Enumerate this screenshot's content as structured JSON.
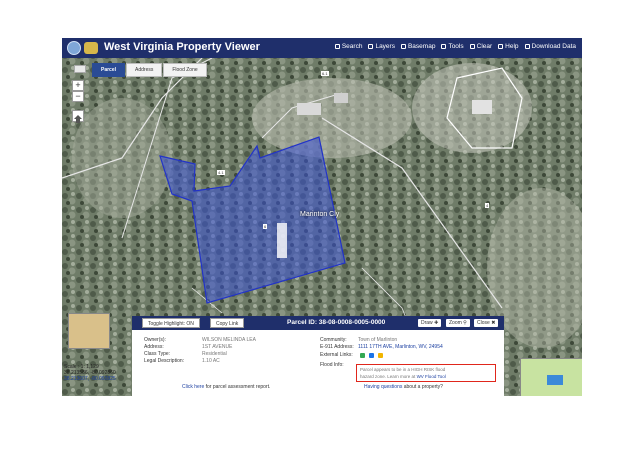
{
  "app": {
    "title": "West Virginia Property Viewer"
  },
  "nav": [
    {
      "icon": "search-icon",
      "label": "Search"
    },
    {
      "icon": "layers-icon",
      "label": "Layers"
    },
    {
      "icon": "basemap-icon",
      "label": "Basemap"
    },
    {
      "icon": "tools-icon",
      "label": "Tools"
    },
    {
      "icon": "clear-icon",
      "label": "Clear"
    },
    {
      "icon": "help-icon",
      "label": "Help"
    },
    {
      "icon": "download-icon",
      "label": "Download Data"
    }
  ],
  "tabs": [
    {
      "label": "Parcel",
      "active": true
    },
    {
      "label": "Address",
      "active": false
    },
    {
      "label": "Flood Zone",
      "active": false
    }
  ],
  "map": {
    "zoom_in": "+",
    "zoom_out": "−",
    "road_label": "Marinton Cly",
    "lot_numbers": [
      "6.1",
      "4",
      "6",
      "4.1"
    ],
    "highlight_color": "#3a52d6"
  },
  "scale": {
    "scale_text": "Scale : 1: 1,129",
    "coord1": "38.213586, -80.092860",
    "coord2": "38.213607, -80.092825"
  },
  "panel": {
    "toggle_label": "Toggle Highlight: ON",
    "copy_label": "Copy Link",
    "parcel_id": "Parcel ID: 38-08-0008-0005-0000",
    "draw_label": "Draw",
    "zoom_label": "Zoom",
    "close_label": "Close",
    "owners_label": "Owner(s):",
    "owners_value": "WILSON MELINDA LEA",
    "address_label": "Address:",
    "address_value": "1ST AVENUE",
    "class_label": "Class Type:",
    "class_value": "Residential",
    "legal_label": "Legal Description:",
    "legal_value": "1.10 AC",
    "community_label": "Community:",
    "community_value": "Town of Marlinton",
    "e911_label": "E-911 Address:",
    "e911_value": "1111 17TH AVE, Marlinton, WV, 24954",
    "external_label": "External Links:",
    "flood_label": "Flood Info:",
    "flood_line1": "Parcel appears to be in a HIGH RISK flood",
    "flood_line2_prefix": "hazard zone. Learn more at",
    "flood_link": "WV Flood Tool",
    "assessment_prefix": "Click here",
    "assessment_rest": "for parcel assessment report.",
    "questions_link": "Having questions",
    "questions_rest": "about a property?"
  }
}
